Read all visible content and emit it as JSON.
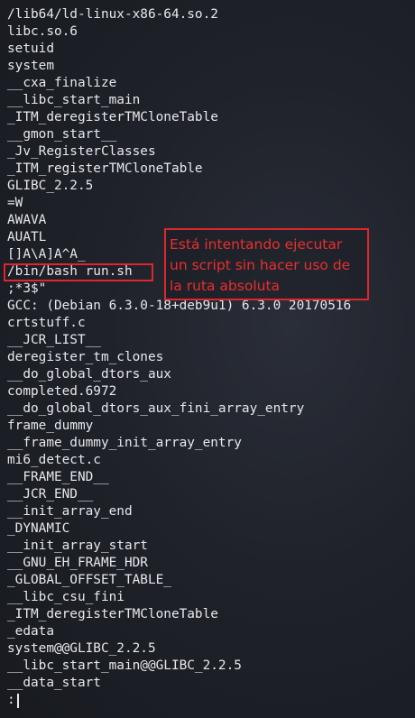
{
  "terminal": {
    "lines": [
      "/lib64/ld-linux-x86-64.so.2",
      "libc.so.6",
      "setuid",
      "system",
      "__cxa_finalize",
      "__libc_start_main",
      "_ITM_deregisterTMCloneTable",
      "__gmon_start__",
      "_Jv_RegisterClasses",
      "_ITM_registerTMCloneTable",
      "GLIBC_2.2.5",
      "=W",
      "AWAVA",
      "AUATL",
      "[]A\\A]A^A_",
      "/bin/bash run.sh",
      ";*3$\"",
      "GCC: (Debian 6.3.0-18+deb9u1) 6.3.0 20170516",
      "crtstuff.c",
      "__JCR_LIST__",
      "deregister_tm_clones",
      "__do_global_dtors_aux",
      "completed.6972",
      "__do_global_dtors_aux_fini_array_entry",
      "frame_dummy",
      "__frame_dummy_init_array_entry",
      "mi6_detect.c",
      "__FRAME_END__",
      "__JCR_END__",
      "__init_array_end",
      "_DYNAMIC",
      "__init_array_start",
      "__GNU_EH_FRAME_HDR",
      "_GLOBAL_OFFSET_TABLE_",
      "__libc_csu_fini",
      "_ITM_deregisterTMCloneTable",
      "_edata",
      "system@@GLIBC_2.2.5",
      "__libc_start_main@@GLIBC_2.2.5",
      "__data_start"
    ],
    "prompt": ":"
  },
  "annotation": {
    "text": "Está intentando ejecutar un script sin hacer uso de la ruta absoluta"
  },
  "colors": {
    "background": "#1c1f26",
    "text": "#e8e8ec",
    "annotation": "#e0262c"
  }
}
